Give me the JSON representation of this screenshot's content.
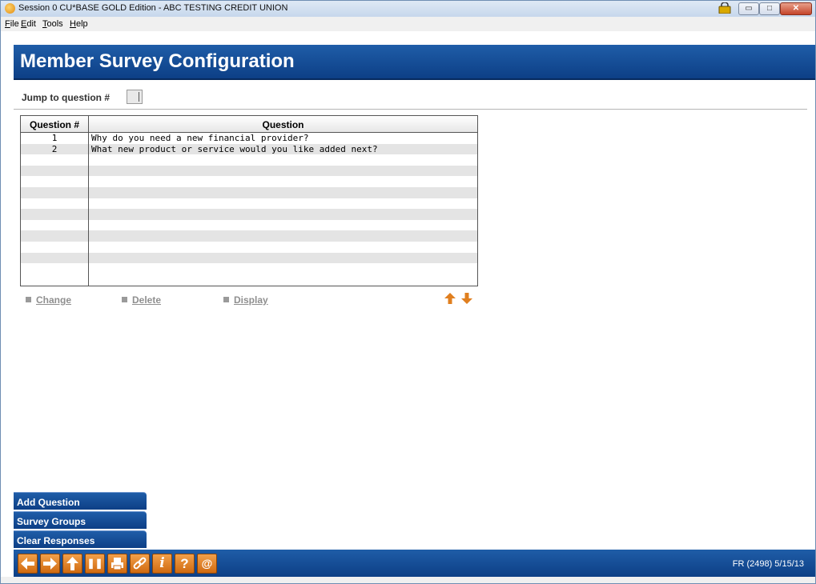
{
  "window": {
    "title": "Session 0 CU*BASE GOLD Edition - ABC TESTING CREDIT UNION",
    "min_glyph": "▭",
    "max_glyph": "□",
    "close_glyph": "✕"
  },
  "menu": [
    {
      "label": "File",
      "hotkey": "F"
    },
    {
      "label": "Edit",
      "hotkey": "E"
    },
    {
      "label": "Tools",
      "hotkey": "T"
    },
    {
      "label": "Help",
      "hotkey": "H"
    }
  ],
  "page": {
    "title": "Member Survey Configuration",
    "jump_label": "Jump to question #",
    "jump_value": ""
  },
  "grid": {
    "headers": [
      "Question #",
      "Question"
    ],
    "rows": [
      {
        "num": "1",
        "question": "Why do you need a new financial provider?"
      },
      {
        "num": "2",
        "question": "What new product or service would you like added next?"
      }
    ],
    "empty_rows": 11
  },
  "actions": [
    "Change",
    "Delete",
    "Display"
  ],
  "scroll_arrows": {
    "up": "🡅",
    "down": "🡇"
  },
  "side_buttons": [
    "Add Question",
    "Survey Groups",
    "Clear Responses"
  ],
  "toolbar": [
    {
      "name": "back-icon",
      "glyph": "🡄"
    },
    {
      "name": "forward-icon",
      "glyph": "🡆"
    },
    {
      "name": "up-icon",
      "glyph": "🡅"
    },
    {
      "name": "pause-icon",
      "glyph": "❚❚"
    },
    {
      "name": "print-icon",
      "glyph": "⎙"
    },
    {
      "name": "link-icon",
      "glyph": "🔗"
    },
    {
      "name": "info-icon",
      "glyph": "i"
    },
    {
      "name": "help-icon",
      "glyph": "?"
    },
    {
      "name": "email-icon",
      "glyph": "@"
    }
  ],
  "status": "FR (2498) 5/15/13",
  "colors": {
    "header_blue": "#1f5da8",
    "accent_orange": "#e07f1f",
    "disabled_gray": "#8f8f8f"
  }
}
